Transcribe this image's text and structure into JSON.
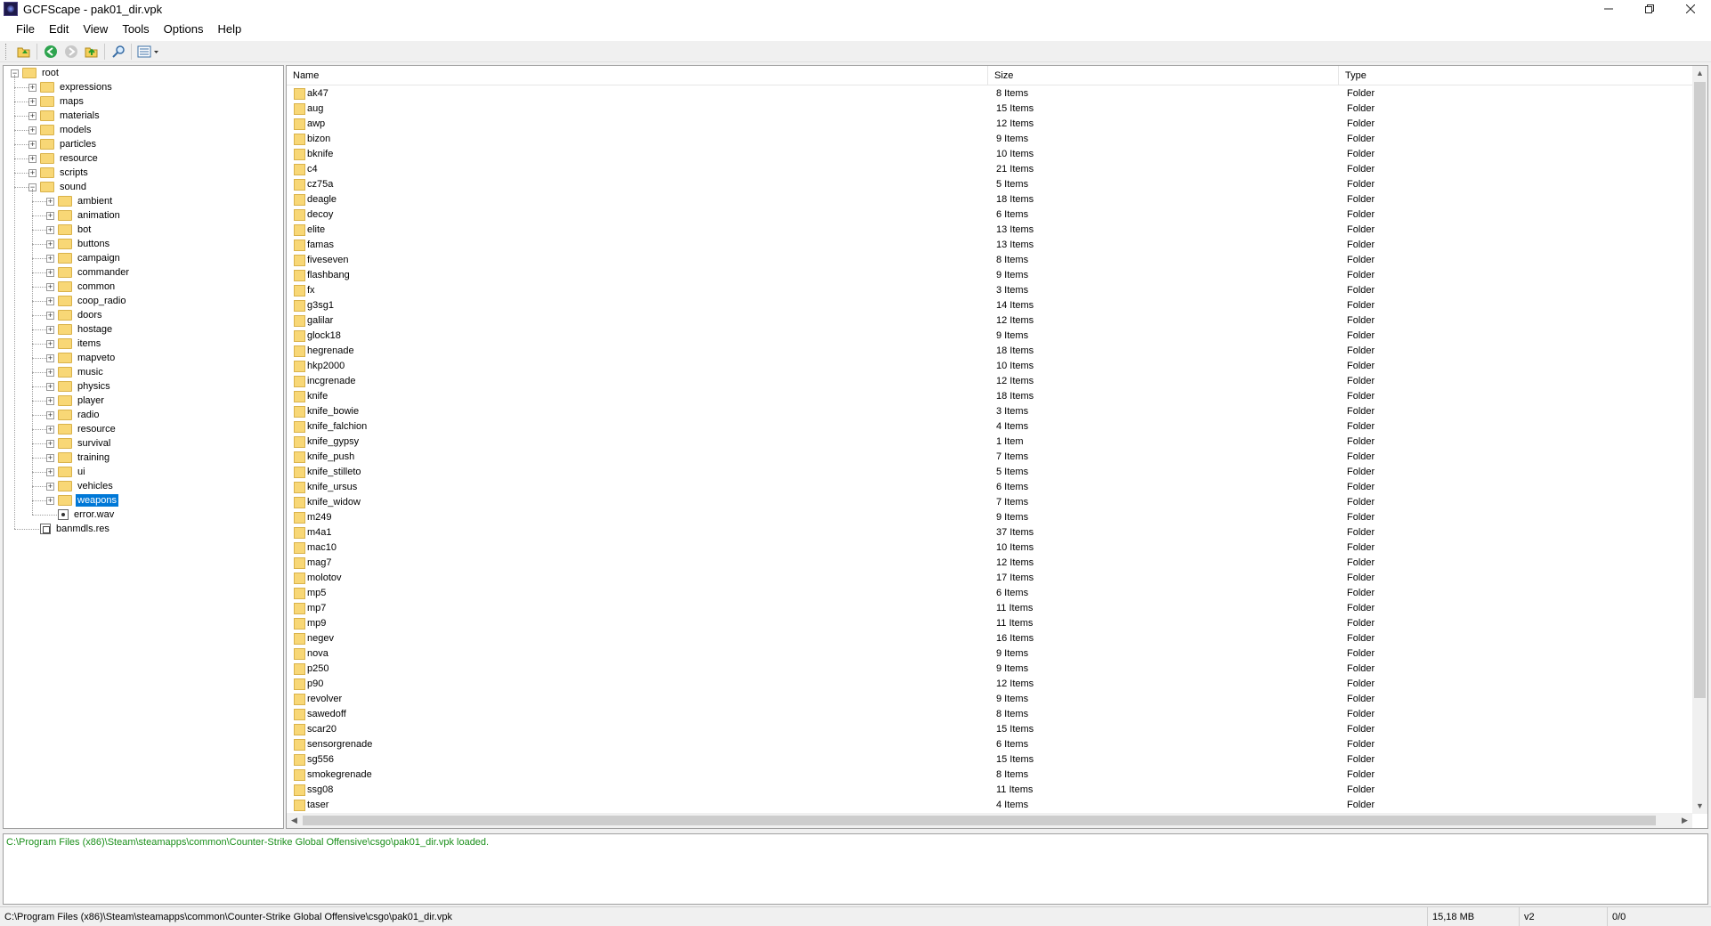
{
  "window": {
    "title": "GCFScape - pak01_dir.vpk",
    "controls": [
      "minimize",
      "restore",
      "close"
    ]
  },
  "menu": [
    "File",
    "Edit",
    "View",
    "Tools",
    "Options",
    "Help"
  ],
  "toolbar": {
    "buttons": [
      "open-folder-icon",
      "back-icon",
      "forward-icon",
      "up-folder-icon",
      "find-icon",
      "view-mode-icon"
    ]
  },
  "tree": {
    "root": "root",
    "top_level": [
      "expressions",
      "maps",
      "materials",
      "models",
      "particles",
      "resource",
      "scripts",
      "sound"
    ],
    "sound_children": [
      "ambient",
      "animation",
      "bot",
      "buttons",
      "campaign",
      "commander",
      "common",
      "coop_radio",
      "doors",
      "hostage",
      "items",
      "mapveto",
      "music",
      "physics",
      "player",
      "radio",
      "resource",
      "survival",
      "training",
      "ui",
      "vehicles",
      "weapons"
    ],
    "sound_files": [
      "error.wav"
    ],
    "root_files": [
      "banmdls.res"
    ],
    "selected": "weapons"
  },
  "list": {
    "columns": [
      "Name",
      "Size",
      "Type"
    ],
    "rows": [
      [
        "ak47",
        "8 Items",
        "Folder"
      ],
      [
        "aug",
        "15 Items",
        "Folder"
      ],
      [
        "awp",
        "12 Items",
        "Folder"
      ],
      [
        "bizon",
        "9 Items",
        "Folder"
      ],
      [
        "bknife",
        "10 Items",
        "Folder"
      ],
      [
        "c4",
        "21 Items",
        "Folder"
      ],
      [
        "cz75a",
        "5 Items",
        "Folder"
      ],
      [
        "deagle",
        "18 Items",
        "Folder"
      ],
      [
        "decoy",
        "6 Items",
        "Folder"
      ],
      [
        "elite",
        "13 Items",
        "Folder"
      ],
      [
        "famas",
        "13 Items",
        "Folder"
      ],
      [
        "fiveseven",
        "8 Items",
        "Folder"
      ],
      [
        "flashbang",
        "9 Items",
        "Folder"
      ],
      [
        "fx",
        "3 Items",
        "Folder"
      ],
      [
        "g3sg1",
        "14 Items",
        "Folder"
      ],
      [
        "galilar",
        "12 Items",
        "Folder"
      ],
      [
        "glock18",
        "9 Items",
        "Folder"
      ],
      [
        "hegrenade",
        "18 Items",
        "Folder"
      ],
      [
        "hkp2000",
        "10 Items",
        "Folder"
      ],
      [
        "incgrenade",
        "12 Items",
        "Folder"
      ],
      [
        "knife",
        "18 Items",
        "Folder"
      ],
      [
        "knife_bowie",
        "3 Items",
        "Folder"
      ],
      [
        "knife_falchion",
        "4 Items",
        "Folder"
      ],
      [
        "knife_gypsy",
        "1 Item",
        "Folder"
      ],
      [
        "knife_push",
        "7 Items",
        "Folder"
      ],
      [
        "knife_stilleto",
        "5 Items",
        "Folder"
      ],
      [
        "knife_ursus",
        "6 Items",
        "Folder"
      ],
      [
        "knife_widow",
        "7 Items",
        "Folder"
      ],
      [
        "m249",
        "9 Items",
        "Folder"
      ],
      [
        "m4a1",
        "37 Items",
        "Folder"
      ],
      [
        "mac10",
        "10 Items",
        "Folder"
      ],
      [
        "mag7",
        "12 Items",
        "Folder"
      ],
      [
        "molotov",
        "17 Items",
        "Folder"
      ],
      [
        "mp5",
        "6 Items",
        "Folder"
      ],
      [
        "mp7",
        "11 Items",
        "Folder"
      ],
      [
        "mp9",
        "11 Items",
        "Folder"
      ],
      [
        "negev",
        "16 Items",
        "Folder"
      ],
      [
        "nova",
        "9 Items",
        "Folder"
      ],
      [
        "p250",
        "9 Items",
        "Folder"
      ],
      [
        "p90",
        "12 Items",
        "Folder"
      ],
      [
        "revolver",
        "9 Items",
        "Folder"
      ],
      [
        "sawedoff",
        "8 Items",
        "Folder"
      ],
      [
        "scar20",
        "15 Items",
        "Folder"
      ],
      [
        "sensorgrenade",
        "6 Items",
        "Folder"
      ],
      [
        "sg556",
        "15 Items",
        "Folder"
      ],
      [
        "smokegrenade",
        "8 Items",
        "Folder"
      ],
      [
        "ssg08",
        "11 Items",
        "Folder"
      ],
      [
        "taser",
        "4 Items",
        "Folder"
      ]
    ]
  },
  "log": {
    "lines": [
      "C:\\Program Files (x86)\\Steam\\steamapps\\common\\Counter-Strike Global Offensive\\csgo\\pak01_dir.vpk loaded."
    ],
    "color": "#1a8f1a"
  },
  "status": {
    "path": "C:\\Program Files (x86)\\Steam\\steamapps\\common\\Counter-Strike Global Offensive\\csgo\\pak01_dir.vpk",
    "size": "15,18 MB",
    "version": "v2",
    "count": "0/0"
  },
  "colors": {
    "selection": "#0078d7",
    "folder": "#f8d776"
  }
}
